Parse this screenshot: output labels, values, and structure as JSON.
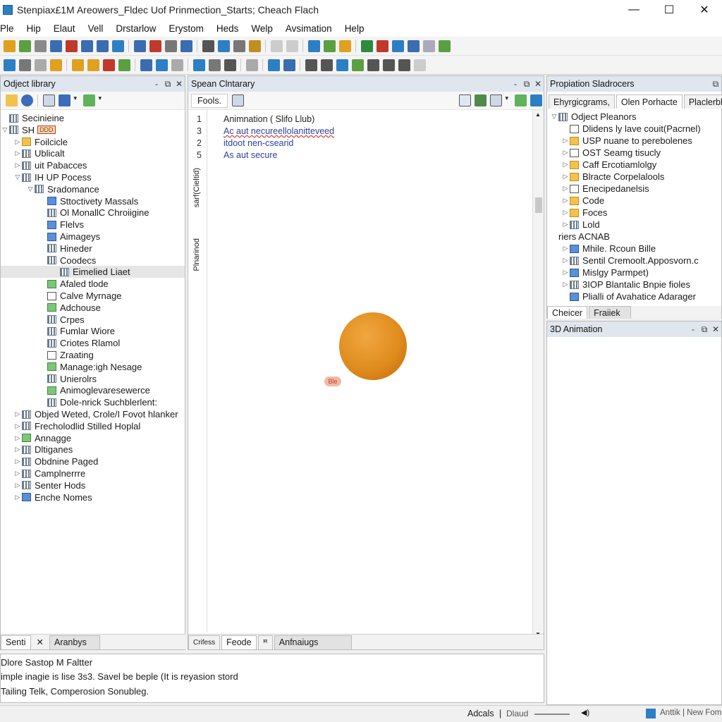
{
  "window": {
    "title": "Stenpiax£1M Areowers_Fldec Uof Prinmection_Starts; Cheach Flach",
    "minimize": "—",
    "maximize": "☐",
    "close": "✕"
  },
  "menu": [
    "Ple",
    "Hip",
    "Elaut",
    "Vell",
    "Drstarlow",
    "Erystom",
    "Heds",
    "Welp",
    "Avsimation",
    "Help"
  ],
  "left_panel": {
    "title": "Odject library",
    "tree": [
      {
        "label": "Secinieine",
        "indent": 0,
        "arrow": "",
        "icon": "grid"
      },
      {
        "label": "SH",
        "indent": 0,
        "arrow": "▽",
        "icon": "grid",
        "badge": "DDD"
      },
      {
        "label": "Foilcicle",
        "indent": 1,
        "arrow": "▷",
        "icon": "folder"
      },
      {
        "label": "Ublicalt",
        "indent": 1,
        "arrow": "▷",
        "icon": "grid"
      },
      {
        "label": "uit Pabacces",
        "indent": 1,
        "arrow": "▷",
        "icon": "grid"
      },
      {
        "label": "IH UP Pocess",
        "indent": 1,
        "arrow": "▽",
        "icon": "grid"
      },
      {
        "label": "Sradomance",
        "indent": 2,
        "arrow": "▽",
        "icon": "grid"
      },
      {
        "label": "Sttoctivety Massals",
        "indent": 3,
        "arrow": "",
        "icon": "blue"
      },
      {
        "label": "Ol MonallC Chroiigine",
        "indent": 3,
        "arrow": "",
        "icon": "grid"
      },
      {
        "label": "Flelvs",
        "indent": 3,
        "arrow": "",
        "icon": "blue"
      },
      {
        "label": "Aimageys",
        "indent": 3,
        "arrow": "",
        "icon": "blue"
      },
      {
        "label": "Hineder",
        "indent": 3,
        "arrow": "",
        "icon": "grid"
      },
      {
        "label": "Coodecs",
        "indent": 3,
        "arrow": "",
        "icon": "grid"
      },
      {
        "label": "Eimelied Liaet",
        "indent": 4,
        "arrow": "",
        "icon": "grid",
        "selected": true
      },
      {
        "label": "Afaled tlode",
        "indent": 3,
        "arrow": "",
        "icon": "green"
      },
      {
        "label": "Calve Myrnage",
        "indent": 3,
        "arrow": "",
        "icon": "box"
      },
      {
        "label": "Adchouse",
        "indent": 3,
        "arrow": "",
        "icon": "green"
      },
      {
        "label": "Crpes",
        "indent": 3,
        "arrow": "",
        "icon": "grid"
      },
      {
        "label": "Fumlar Wiore",
        "indent": 3,
        "arrow": "",
        "icon": "grid"
      },
      {
        "label": "Criotes Rlamol",
        "indent": 3,
        "arrow": "",
        "icon": "grid"
      },
      {
        "label": "Zraating",
        "indent": 3,
        "arrow": "",
        "icon": "box"
      },
      {
        "label": "Manage:igh Nesage",
        "indent": 3,
        "arrow": "",
        "icon": "green"
      },
      {
        "label": "Unierolrs",
        "indent": 3,
        "arrow": "",
        "icon": "grid"
      },
      {
        "label": "Animoglevaresewerce",
        "indent": 3,
        "arrow": "",
        "icon": "green"
      },
      {
        "label": "Dole-nrick Suchblerlent:",
        "indent": 3,
        "arrow": "",
        "icon": "grid"
      },
      {
        "label": "Objed Weted, Crole/I Fovot hlanker",
        "indent": 1,
        "arrow": "▷",
        "icon": "grid"
      },
      {
        "label": "Frecholodlid Stilled Hoplal",
        "indent": 1,
        "arrow": "▷",
        "icon": "grid"
      },
      {
        "label": "Annagge",
        "indent": 1,
        "arrow": "▷",
        "icon": "green"
      },
      {
        "label": "Dltiganes",
        "indent": 1,
        "arrow": "▷",
        "icon": "grid"
      },
      {
        "label": "Obdnine Paged",
        "indent": 1,
        "arrow": "▷",
        "icon": "grid"
      },
      {
        "label": "Camplnerrre",
        "indent": 1,
        "arrow": "▷",
        "icon": "grid"
      },
      {
        "label": "Senter Hods",
        "indent": 1,
        "arrow": "▷",
        "icon": "grid"
      },
      {
        "label": "Enche Nomes",
        "indent": 1,
        "arrow": "▷",
        "icon": "blue"
      }
    ],
    "bottom_tabs": [
      "Senti",
      "✕",
      "Aranbys"
    ]
  },
  "center_panel": {
    "title": "Spean Clntarary",
    "tool_label": "Fools.",
    "lines": [
      {
        "num": "1",
        "text": "Animnation ( Slifo Llub)",
        "color": "#222"
      },
      {
        "num": "3",
        "text": "Ac aut necureellolanitteveed",
        "color": "#2b3fa0"
      },
      {
        "num": "2",
        "text": "itdoot nen-csearid",
        "color": "#2b3fa0"
      },
      {
        "num": "5",
        "text": "As aut secure",
        "color": "#2b3fa0"
      }
    ],
    "side_labels": [
      "sarf(Cieltid)",
      "Plnarinod"
    ],
    "ball_label": "Ble",
    "bottom_tabs": [
      "Crifess",
      "Feode",
      "ꟸ",
      "Anfnaiugs"
    ]
  },
  "right_panel": {
    "title": "Propiation Sladrocers",
    "tabs": [
      "Ehyrgicgrams,",
      "Olen Porhacte",
      "Placlerblr"
    ],
    "tree": [
      {
        "label": "Odject Pleanors",
        "indent": 0,
        "arrow": "▽",
        "icon": "grid"
      },
      {
        "label": "Dlidens ly lave couit(Pacrnel)",
        "indent": 1,
        "arrow": "",
        "icon": "box"
      },
      {
        "label": "USP nuane to perebolenes",
        "indent": 1,
        "arrow": "▷",
        "icon": "folder"
      },
      {
        "label": "OST Seamg tisucly",
        "indent": 1,
        "arrow": "▷",
        "icon": "box"
      },
      {
        "label": "Caff Ercotiamlolgy",
        "indent": 1,
        "arrow": "▷",
        "icon": "folder"
      },
      {
        "label": "Blracte Corpelalools",
        "indent": 1,
        "arrow": "▷",
        "icon": "folder"
      },
      {
        "label": "Enecipedanelsis",
        "indent": 1,
        "arrow": "▷",
        "icon": "box"
      },
      {
        "label": "Code",
        "indent": 1,
        "arrow": "▷",
        "icon": "folder"
      },
      {
        "label": "Foces",
        "indent": 1,
        "arrow": "▷",
        "icon": "folder"
      },
      {
        "label": "Lold",
        "indent": 1,
        "arrow": "▷",
        "icon": "grid"
      },
      {
        "label": "riers ACNAB",
        "indent": 0,
        "arrow": "",
        "icon": ""
      },
      {
        "label": "Mhile. Rcoun Bille",
        "indent": 1,
        "arrow": "▷",
        "icon": "blue"
      },
      {
        "label": "Sentil Cremoolt.Apposvorn.c",
        "indent": 1,
        "arrow": "▷",
        "icon": "grid"
      },
      {
        "label": "Mislgy Parmpet)",
        "indent": 1,
        "arrow": "▷",
        "icon": "blue"
      },
      {
        "label": "3IOP Blantalic Bnpie fioles",
        "indent": 1,
        "arrow": "▷",
        "icon": "grid"
      },
      {
        "label": "Plialli of Avahatice Adarager",
        "indent": 1,
        "arrow": "",
        "icon": "blue"
      }
    ],
    "bottom_tabs": [
      "Cheicer",
      "Fraiiek"
    ],
    "anim_title": "3D Animation"
  },
  "status": {
    "lines": [
      "Dlore Sastop M Faltter",
      "imple inagie is lise 3s3. Savel be beple (It is reyasion stord",
      "Tailing Telk, Comperosion Sonubleg."
    ]
  },
  "footer": {
    "left": "Adcals",
    "sep": "|",
    "mid": "Dlaud",
    "right": "Anttik | New Fom"
  },
  "colors": {
    "accent": "#2d7fc4",
    "panel_header": "#dfe6ee",
    "ball": "#e08c1e"
  }
}
